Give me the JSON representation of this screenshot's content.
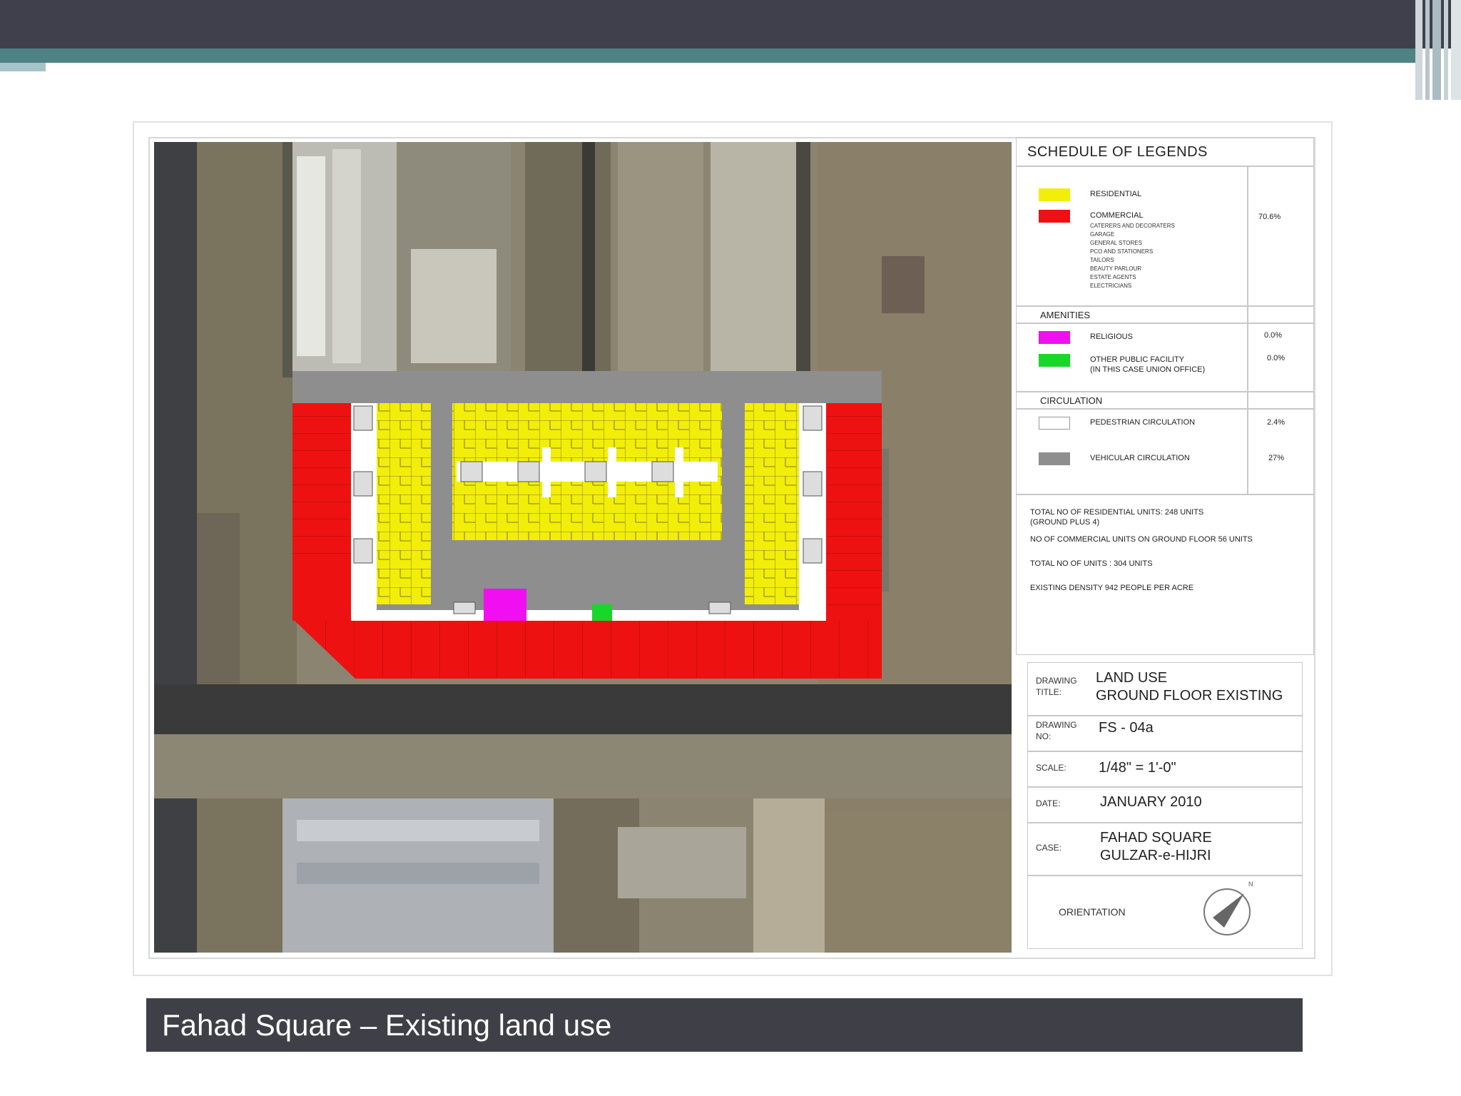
{
  "slide": {
    "caption": "Fahad Square – Existing land use"
  },
  "legend": {
    "title": "SCHEDULE OF LEGENDS",
    "items": [
      {
        "label": "RESIDENTIAL",
        "color": "#f2ee0a"
      },
      {
        "label": "COMMERCIAL",
        "color": "#ee1111",
        "percent": "70.6%"
      }
    ],
    "commercial_subtypes": [
      "CATERERS AND DECORATERS",
      "GARAGE",
      "GENERAL STORES",
      "PCO AND STATIONERS",
      "TAILORS",
      "BEAUTY PARLOUR",
      "ESTATE AGENTS",
      "ELECTRICIANS"
    ],
    "amenities": {
      "heading": "AMENITIES",
      "items": [
        {
          "label": "RELIGIOUS",
          "color": "#f00ff0",
          "percent": "0.0%"
        },
        {
          "label": "OTHER PUBLIC FACILITY",
          "label2": "(IN THIS CASE UNION OFFICE)",
          "color": "#18d62a",
          "percent": "0.0%"
        }
      ]
    },
    "circulation": {
      "heading": "CIRCULATION",
      "items": [
        {
          "label": "PEDESTRIAN CIRCULATION",
          "color": "#ffffff",
          "percent": "2.4%"
        },
        {
          "label": "VEHICULAR CIRCULATION",
          "color": "#8e8e8e",
          "percent": "27%"
        }
      ]
    },
    "stats": [
      "TOTAL NO OF RESIDENTIAL UNITS: 248 UNITS",
      "(GROUND PLUS 4)",
      "NO OF COMMERCIAL UNITS ON GROUND FLOOR  56 UNITS",
      "TOTAL NO OF UNITS : 304 UNITS",
      "EXISTING DENSITY 942  PEOPLE PER ACRE"
    ]
  },
  "title_block": {
    "drawing_title_label": [
      "DRAWING",
      "TITLE:"
    ],
    "drawing_title_value": [
      "LAND USE",
      "GROUND FLOOR  EXISTING"
    ],
    "drawing_no_label": [
      "DRAWING",
      "NO:"
    ],
    "drawing_no_value": "FS - 04a",
    "scale_label": "SCALE:",
    "scale_value": "1/48\" = 1'-0\"",
    "date_label": "DATE:",
    "date_value": "JANUARY 2010",
    "case_label": "CASE:",
    "case_value": [
      "FAHAD SQUARE",
      "GULZAR-e-HIJRI"
    ],
    "orientation_label": "ORIENTATION",
    "north_label": "N"
  },
  "colors": {
    "residential": "#f2ee0a",
    "commercial": "#ee1111",
    "religious": "#f00ff0",
    "public_facility": "#18d62a",
    "vehicular": "#8e8e8e",
    "pedestrian": "#ffffff"
  }
}
